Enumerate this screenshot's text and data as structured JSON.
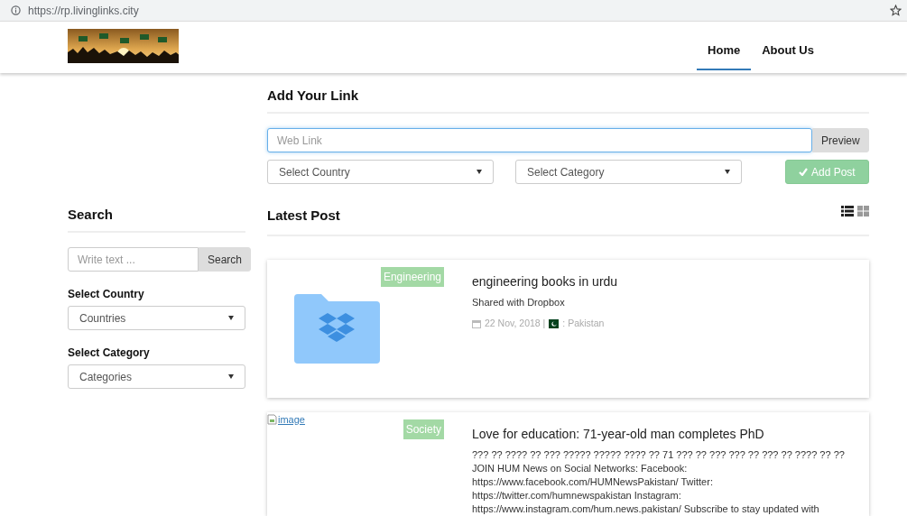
{
  "browser": {
    "url": "https://rp.livinglinks.city"
  },
  "nav": {
    "items": [
      {
        "label": "Home",
        "selected": true
      },
      {
        "label": "About Us",
        "selected": false
      }
    ]
  },
  "add_link": {
    "title": "Add Your Link",
    "link_field": {
      "placeholder": "Web Link"
    },
    "preview_button": "Preview",
    "country_select": "Select Country",
    "category_select": "Select Category",
    "add_button": "Add Post"
  },
  "sidebar": {
    "title": "Search",
    "search_field": {
      "placeholder": "Write text ..."
    },
    "search_button": "Search",
    "country_label": "Select Country",
    "country_select": "Countries",
    "category_label": "Select Category",
    "category_select": "Categories"
  },
  "latest": {
    "title": "Latest Post",
    "views": [
      {
        "kind": "list",
        "selected": true
      },
      {
        "kind": "grid",
        "selected": false
      }
    ]
  },
  "posts": [
    {
      "kind": "folder",
      "category": "Engineering",
      "title": "engineering books in urdu",
      "description": "Shared with Dropbox",
      "date": "22 Nov, 2018 |",
      "country": ": Pakistan"
    },
    {
      "kind": "broken",
      "image_alt": "image",
      "category": "Society",
      "title": "Love for education: 71-year-old man completes PhD",
      "description": "??? ?? ???? ?? ??? ????? ????? ???? ?? 71 ??? ?? ??? ??? ?? ??? ?? ???? ?? ?? JOIN HUM News on Social Networks: Facebook: https://www.facebook.com/HUMNewsPakistan/ Twitter: https://twitter.com/humnewspakistan Instagram: https://www.instagram.com/hum.news.pakistan/ Subscribe to stay updated with"
    }
  ]
}
